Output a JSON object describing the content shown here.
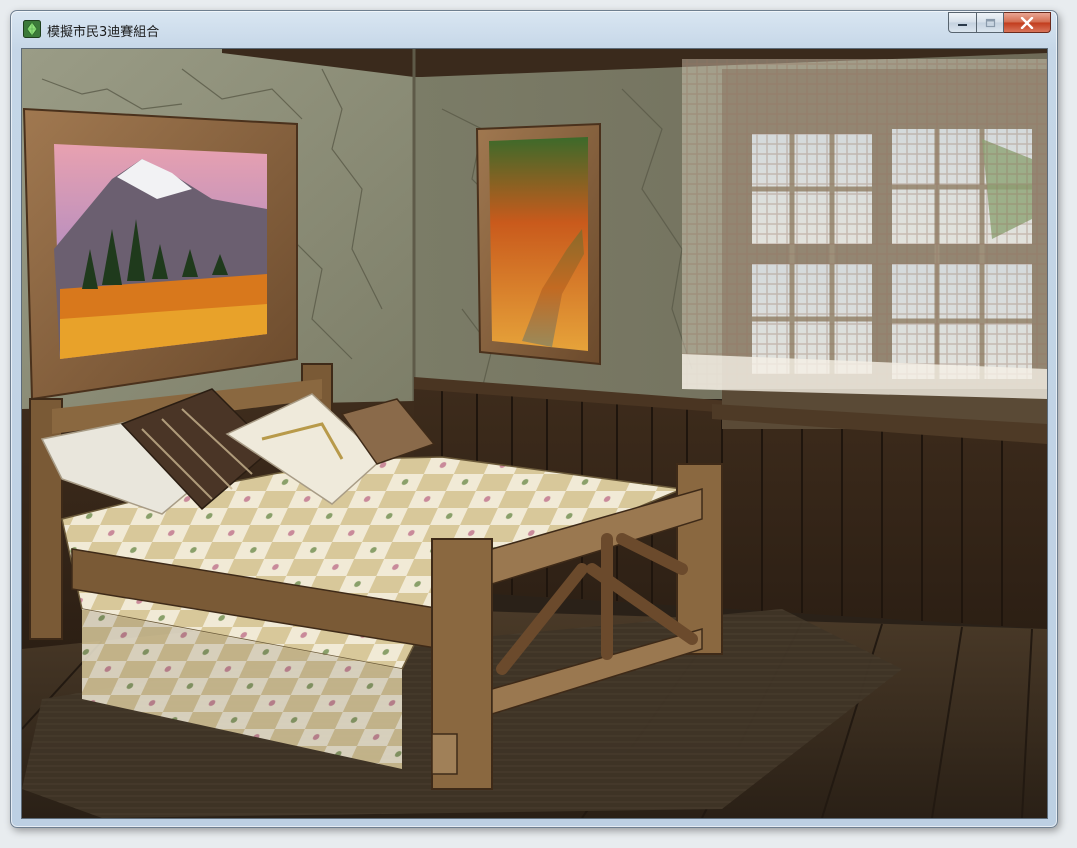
{
  "window": {
    "title": "模擬市民3迪賽組合",
    "icon": "sims-plumbob-icon",
    "controls": [
      "minimize",
      "maximize",
      "close"
    ]
  },
  "scene": {
    "description_type": "game-viewport",
    "objects": [
      "mountain-painting",
      "autumn-path-painting",
      "window-with-curtains",
      "wooden-bed",
      "patchwork-quilt",
      "pillows",
      "rug",
      "wood-floor",
      "wainscot-paneling",
      "cracked-plaster-wall"
    ]
  },
  "colors": {
    "close_button": "#c9472a",
    "titlebar": "#c9d9ea",
    "wall": "#8a8a72",
    "wood": "#7a5a36",
    "floor": "#3a2c1e"
  }
}
